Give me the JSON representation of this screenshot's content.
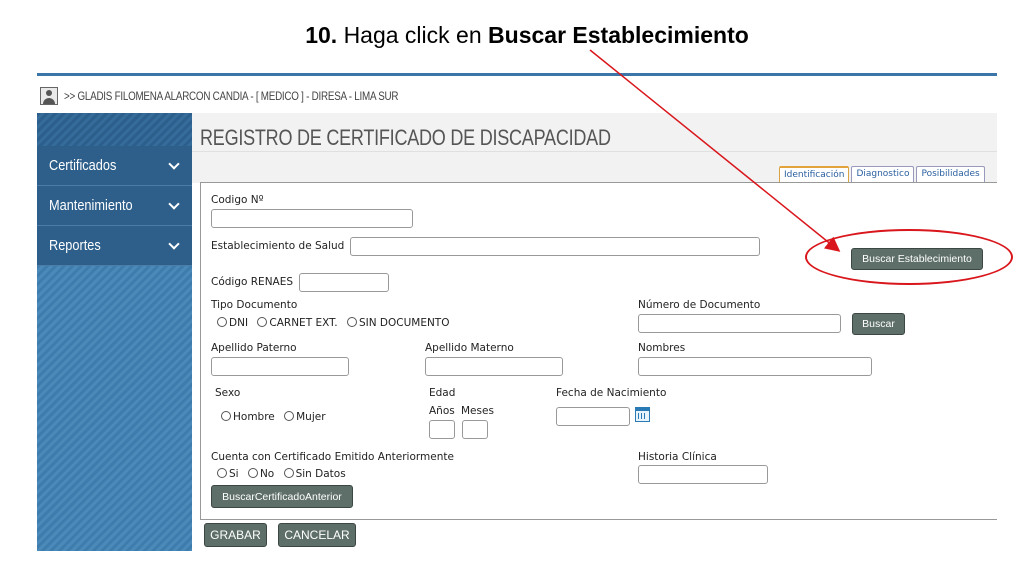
{
  "slide": {
    "step_number": "10.",
    "instruction_prefix": "Haga click en",
    "instruction_target": "Buscar Establecimiento"
  },
  "user_bar": {
    "text": ">> GLADIS FILOMENA ALARCON CANDIA - [ MEDICO ] - DIRESA - LIMA SUR"
  },
  "sidebar": {
    "items": [
      {
        "label": "Certificados"
      },
      {
        "label": "Mantenimiento"
      },
      {
        "label": "Reportes"
      }
    ]
  },
  "page": {
    "title": "REGISTRO DE CERTIFICADO DE DISCAPACIDAD"
  },
  "tabs": [
    {
      "label": "Identificación",
      "active": true
    },
    {
      "label": "Diagnostico",
      "active": false
    },
    {
      "label": "Posibilidades",
      "active": false
    }
  ],
  "form": {
    "codigo_label": "Codigo Nº",
    "codigo_value": "",
    "establecimiento_label": "Establecimiento de Salud",
    "establecimiento_value": "",
    "buscar_establecimiento_label": "Buscar Establecimiento",
    "renaes_label": "Código RENAES",
    "renaes_value": "",
    "tipo_documento_label": "Tipo Documento",
    "tipo_documento_options": [
      "DNI",
      "CARNET EXT.",
      "SIN DOCUMENTO"
    ],
    "numero_documento_label": "Número de Documento",
    "numero_documento_value": "",
    "buscar_label": "Buscar",
    "apellido_paterno_label": "Apellido Paterno",
    "apellido_materno_label": "Apellido Materno",
    "nombres_label": "Nombres",
    "sexo_label": "Sexo",
    "sexo_options": [
      "Hombre",
      "Mujer"
    ],
    "edad_label": "Edad",
    "anos_label": "Años",
    "meses_label": "Meses",
    "fecha_nacimiento_label": "Fecha de Nacimiento",
    "certificado_anterior_label": "Cuenta con Certificado Emitido Anteriormente",
    "certificado_anterior_options": [
      "Si",
      "No",
      "Sin Datos"
    ],
    "historia_clinica_label": "Historia Clínica",
    "buscar_certificado_label": "BuscarCertificadoAnterior"
  },
  "actions": {
    "grabar_label": "GRABAR",
    "cancelar_label": "CANCELAR"
  },
  "annotation": {
    "color": "#d9161c"
  }
}
